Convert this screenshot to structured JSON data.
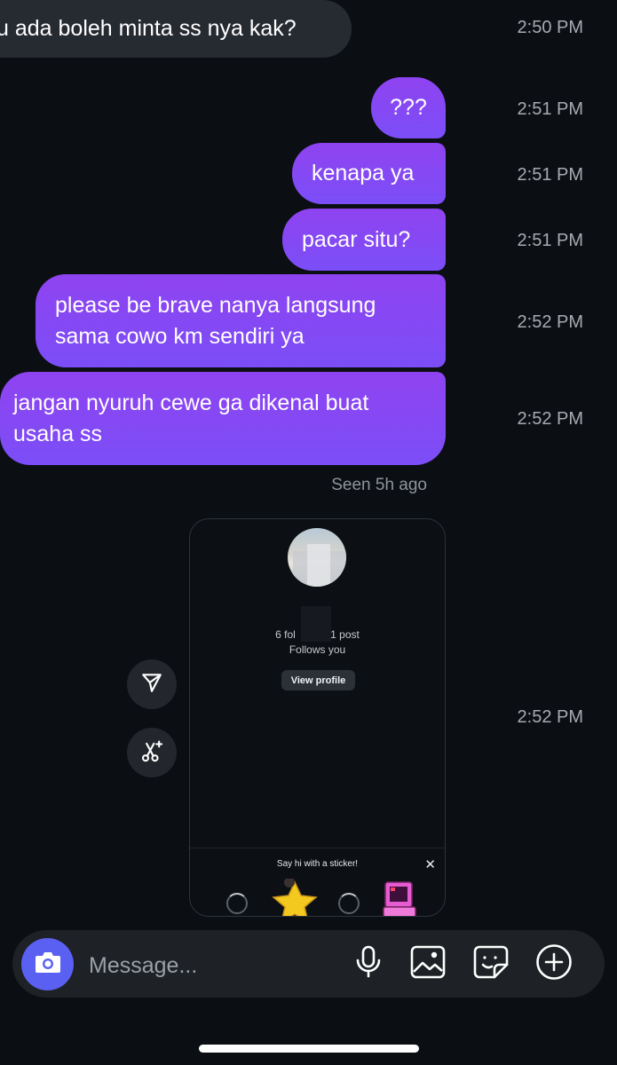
{
  "messages": [
    {
      "text": "u ada boleh minta ss nya kak?",
      "time": "2:50 PM"
    },
    {
      "text": "???",
      "time": "2:51 PM"
    },
    {
      "text": "kenapa ya",
      "time": "2:51 PM"
    },
    {
      "text": "pacar situ?",
      "time": "2:51 PM"
    },
    {
      "text": "please be brave nanya langsung sama cowo km sendiri ya",
      "time": "2:52 PM"
    },
    {
      "text": "jangan nyuruh cewe ga dikenal buat usaha ss",
      "time": "2:52 PM"
    }
  ],
  "seen_label": "Seen 5h ago",
  "shared_profile": {
    "stats": "6 fol    1 post",
    "follows_you": "Follows you",
    "view_profile_label": "View profile",
    "sticker_prompt": "Say hi with a sticker!",
    "close_glyph": "✕",
    "time": "2:52 PM"
  },
  "composer": {
    "placeholder": "Message..."
  },
  "icons": {
    "camera": "camera-icon",
    "microphone": "microphone-icon",
    "gallery": "gallery-icon",
    "sticker": "sticker-icon",
    "add": "add-icon",
    "share": "send-icon",
    "remix": "scissors-sparkle-icon"
  },
  "colors": {
    "background": "#0b0f13",
    "outgoing_bubble_top": "#8f43f0",
    "outgoing_bubble_bottom": "#7b4ef7",
    "incoming_bubble": "#262a31",
    "camera_button": "#5a60f1",
    "timestamp": "#a7abb1"
  }
}
